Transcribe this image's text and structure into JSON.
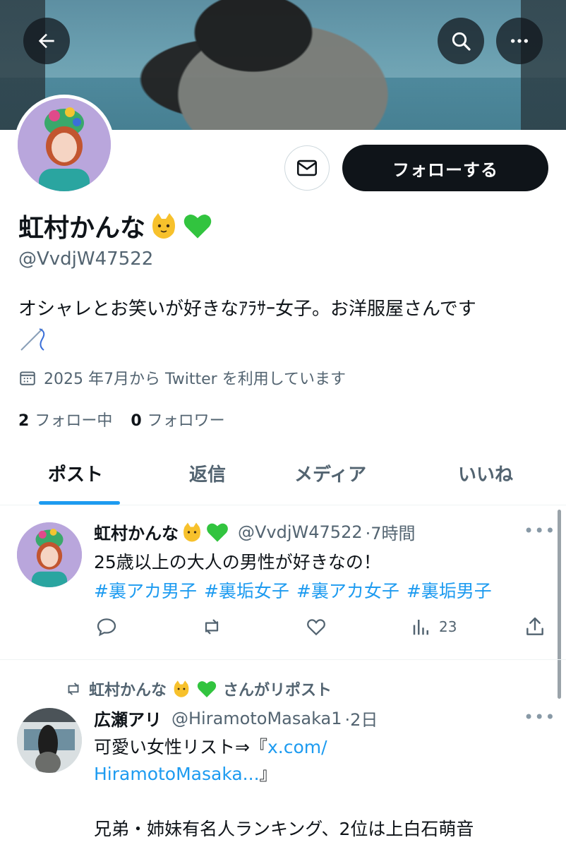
{
  "profile": {
    "display_name": "虹村かんな",
    "handle": "@VvdjW47522",
    "bio": "オシャレとお笑いが好きなｱﾗｻｰ女子。お洋服屋さんです",
    "joined": "2025 年7月から Twitter を利用しています",
    "following_count": "2",
    "following_label": "フォロー中",
    "followers_count": "0",
    "followers_label": "フォロワー",
    "follow_button": "フォローする",
    "name_emojis": [
      "cat-face-emoji",
      "green-heart-emoji"
    ]
  },
  "tabs": [
    {
      "label": "ポスト",
      "active": true
    },
    {
      "label": "返信",
      "active": false
    },
    {
      "label": "メディア",
      "active": false
    },
    {
      "label": "いいね",
      "active": false
    }
  ],
  "posts": [
    {
      "author": "虹村かんな",
      "handle": "@VvdjW47522",
      "time": "·7時間",
      "text": "25歳以上の大人の男性が好きなの！",
      "hashtags": [
        "#裏アカ男子",
        "#裏垢女子",
        "#裏アカ女子",
        "#裏垢男子"
      ],
      "views": "23"
    },
    {
      "repost_by": "虹村かんな",
      "repost_suffix": "さんがリポスト",
      "author": "広瀬アリ",
      "handle": "@HiramotoMasaka1",
      "time": "·2日",
      "text_prefix": "可愛い女性リスト⇒『",
      "link_part1": "x.com/",
      "link_part2": "HiramotoMasaka...",
      "text_suffix": "』",
      "text_line3": "兄弟・姉妹有名人ランキング、2位は上白石萌音"
    }
  ],
  "colors": {
    "accent": "#1d9bf0",
    "text": "#0f1419",
    "muted": "#536471",
    "button_dark": "#0f1419"
  }
}
